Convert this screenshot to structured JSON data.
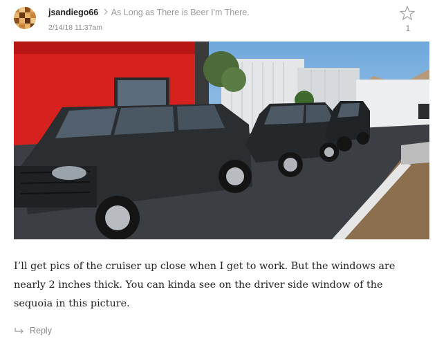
{
  "post": {
    "author": "jsandiego66",
    "in_reply_to": "As Long as There is Beer I'm There.",
    "timestamp": "2/14/18 11:37am",
    "like_count": "1",
    "body_lines": [
      "I’ll get pics of the cruiser up close when I get to work. But the windows are",
      "nearly 2 inches thick. You can kinda see on the driver side window of the",
      "sequoia in this picture."
    ],
    "reply_label": "Reply"
  },
  "icons": {
    "avatar": "avatar-checker-icon",
    "separator": "chevron-right-icon",
    "like": "star-outline-icon",
    "reply": "reply-arrow-icon"
  },
  "colors": {
    "text": "#222222",
    "muted": "#999999",
    "link": "#8a8a8a"
  }
}
